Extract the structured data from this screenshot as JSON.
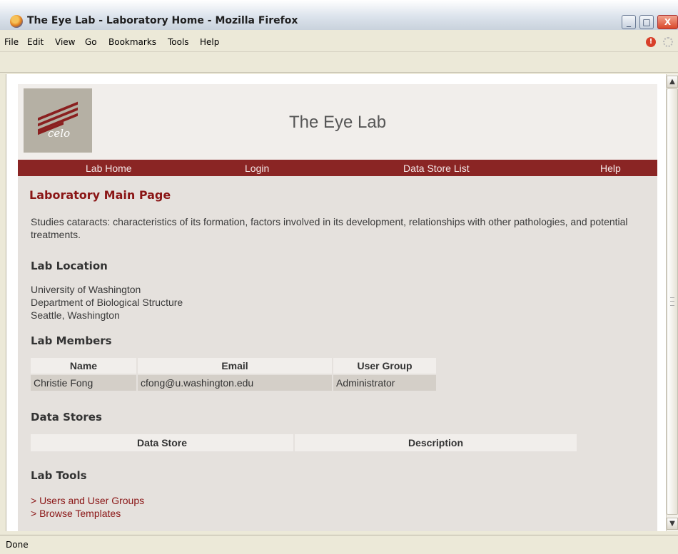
{
  "window": {
    "title": "The Eye Lab - Laboratory Home - Mozilla Firefox",
    "status": "Done",
    "controls": {
      "minimize": "_",
      "maximize": "□",
      "close": "X"
    }
  },
  "menubar": {
    "items": [
      "File",
      "Edit",
      "View",
      "Go",
      "Bookmarks",
      "Tools",
      "Help"
    ]
  },
  "site": {
    "logo_text": "celo",
    "title": "The Eye Lab"
  },
  "nav": {
    "items": [
      "Lab Home",
      "Login",
      "Data Store List",
      "Help"
    ]
  },
  "main": {
    "heading": "Laboratory Main Page",
    "description": "Studies cataracts: characteristics of its formation, factors involved in its development, relationships with other pathologies, and potential treatments.",
    "location_heading": "Lab Location",
    "location_lines": [
      "University of Washington",
      "Department of Biological Structure",
      "Seattle, Washington"
    ],
    "members_heading": "Lab Members",
    "members_table": {
      "headers": [
        "Name",
        "Email",
        "User Group"
      ],
      "rows": [
        [
          "Christie Fong",
          "cfong@u.washington.edu",
          "Administrator"
        ]
      ]
    },
    "stores_heading": "Data Stores",
    "stores_table": {
      "headers": [
        "Data Store",
        "Description"
      ]
    },
    "tools_heading": "Lab Tools",
    "tools": [
      "> Users and User Groups",
      "> Browse Templates"
    ]
  },
  "colors": {
    "accent": "#8a2524",
    "link": "#8a1515",
    "page_bg": "#e5e1dd"
  }
}
